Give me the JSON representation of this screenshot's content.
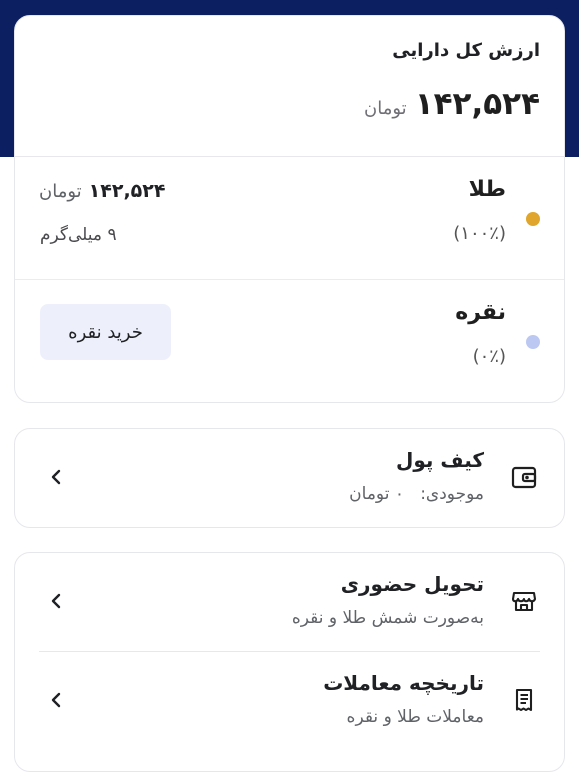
{
  "assets_summary": {
    "total_label": "ارزش کل دارایی",
    "total_value": "۱۴۲,۵۲۴",
    "total_unit": "تومان",
    "gold": {
      "name": "طلا",
      "percent": "(۱۰۰٪)",
      "value": "۱۴۲,۵۲۴",
      "unit": "تومان",
      "weight": "۹ میلی‌گرم",
      "color": "#e0a52c"
    },
    "silver": {
      "name": "نقره",
      "percent": "(۰٪)",
      "buy_label": "خرید نقره",
      "color": "#bcc8f2"
    }
  },
  "wallet": {
    "title": "کیف پول",
    "balance_label": "موجودی:",
    "balance_value": "۰ تومان",
    "icon": "wallet-icon"
  },
  "services": [
    {
      "title": "تحویل حضوری",
      "subtitle": "به‌صورت شمش طلا و نقره",
      "icon": "store-icon"
    },
    {
      "title": "تاریخچه معاملات",
      "subtitle": "معاملات طلا و نقره",
      "icon": "receipt-icon"
    }
  ],
  "colors": {
    "brand_navy": "#0c1f61",
    "border": "#e6e7ec",
    "button_background": "#edf0fb"
  }
}
